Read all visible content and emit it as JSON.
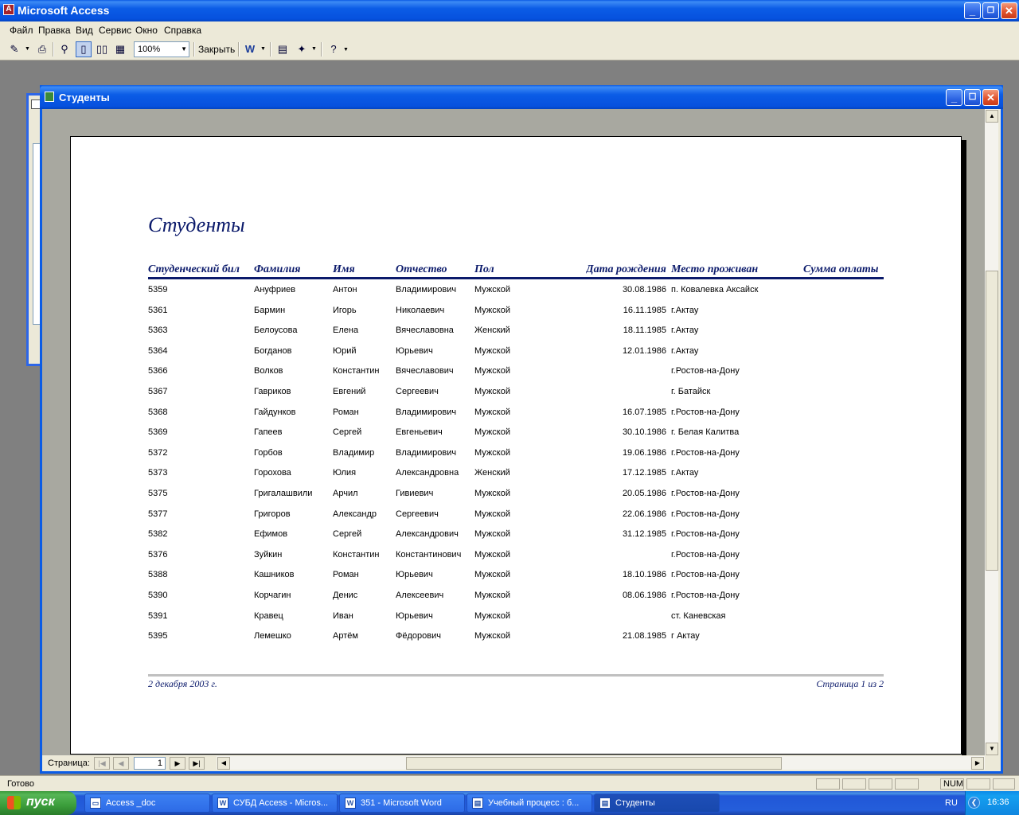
{
  "app": {
    "title": "Microsoft Access",
    "menu": [
      "Файл",
      "Правка",
      "Вид",
      "Сервис",
      "Окно",
      "Справка"
    ]
  },
  "toolbar": {
    "zoom_value": "100%",
    "close_label": "Закрыть",
    "icons": [
      "design-view-icon",
      "print-icon",
      "zoom-icon",
      "one-page-icon",
      "two-pages-icon",
      "multiple-pages-icon",
      "office-links-icon",
      "database-window-icon",
      "new-object-icon",
      "help-icon"
    ]
  },
  "report_window": {
    "title": "Студенты",
    "report": {
      "title": "Студенты",
      "columns": [
        "Студенческий бил",
        "Фамилия",
        "Имя",
        "Отчество",
        "Пол",
        "Дата рождения",
        "Место проживан",
        "Сумма оплаты"
      ],
      "rows": [
        [
          "5359",
          "Ануфриев",
          "Антон",
          "Владимирович",
          "Мужской",
          "30.08.1986",
          "п. Ковалевка Аксайск"
        ],
        [
          "5361",
          "Бармин",
          "Игорь",
          "Николаевич",
          "Мужской",
          "16.11.1985",
          "г.Актау"
        ],
        [
          "5363",
          "Белоусова",
          "Елена",
          "Вячеславовна",
          "Женский",
          "18.11.1985",
          "г.Актау"
        ],
        [
          "5364",
          "Богданов",
          "Юрий",
          "Юрьевич",
          "Мужской",
          "12.01.1986",
          "г.Актау"
        ],
        [
          "5366",
          "Волков",
          "Константин",
          "Вячеславович",
          "Мужской",
          "",
          "г.Ростов-на-Дону"
        ],
        [
          "5367",
          "Гавриков",
          "Евгений",
          "Сергеевич",
          "Мужской",
          "",
          "г. Батайск"
        ],
        [
          "5368",
          "Гайдунков",
          "Роман",
          "Владимирович",
          "Мужской",
          "16.07.1985",
          "г.Ростов-на-Дону"
        ],
        [
          "5369",
          "Гапеев",
          "Сергей",
          "Евгеньевич",
          "Мужской",
          "30.10.1986",
          "г. Белая Калитва"
        ],
        [
          "5372",
          "Горбов",
          "Владимир",
          "Владимирович",
          "Мужской",
          "19.06.1986",
          "г.Ростов-на-Дону"
        ],
        [
          "5373",
          "Горохова",
          "Юлия",
          "Александровна",
          "Женский",
          "17.12.1985",
          "г.Актау"
        ],
        [
          "5375",
          "Григалашвили",
          "Арчил",
          "Гивиевич",
          "Мужской",
          "20.05.1986",
          "г.Ростов-на-Дону"
        ],
        [
          "5377",
          "Григоров",
          "Александр",
          "Сергеевич",
          "Мужской",
          "22.06.1986",
          "г.Ростов-на-Дону"
        ],
        [
          "5382",
          "Ефимов",
          "Сергей",
          "Александрович",
          "Мужской",
          "31.12.1985",
          "г.Ростов-на-Дону"
        ],
        [
          "5376",
          "Зуйкин",
          "Константин",
          "Константинович",
          "Мужской",
          "",
          "г.Ростов-на-Дону"
        ],
        [
          "5388",
          "Кашников",
          "Роман",
          "Юрьевич",
          "Мужской",
          "18.10.1986",
          "г.Ростов-на-Дону"
        ],
        [
          "5390",
          "Корчагин",
          "Денис",
          "Алексеевич",
          "Мужской",
          "08.06.1986",
          "г.Ростов-на-Дону"
        ],
        [
          "5391",
          "Кравец",
          "Иван",
          "Юрьевич",
          "Мужской",
          "",
          "ст. Каневская"
        ],
        [
          "5395",
          "Лемешко",
          "Артём",
          "Фёдорович",
          "Мужской",
          "21.08.1985",
          "г Актау"
        ]
      ],
      "footer_date": "2 декабря 2003 г.",
      "footer_page": "Страница 1 из 2"
    },
    "navigation": {
      "label": "Страница:",
      "current_page": "1"
    }
  },
  "statusbar": {
    "text": "Готово",
    "num": "NUM"
  },
  "taskbar": {
    "start_label": "пуск",
    "tasks": [
      "Access _doc",
      "СУБД Access - Micros...",
      "351 - Microsoft Word",
      "Учебный процесс : б...",
      "Студенты"
    ],
    "lang": "RU",
    "clock": "16:36"
  },
  "colors": {
    "xp_blue": "#0b5ce6",
    "report_heading": "#0b1a6b",
    "face": "#ece9d8"
  }
}
